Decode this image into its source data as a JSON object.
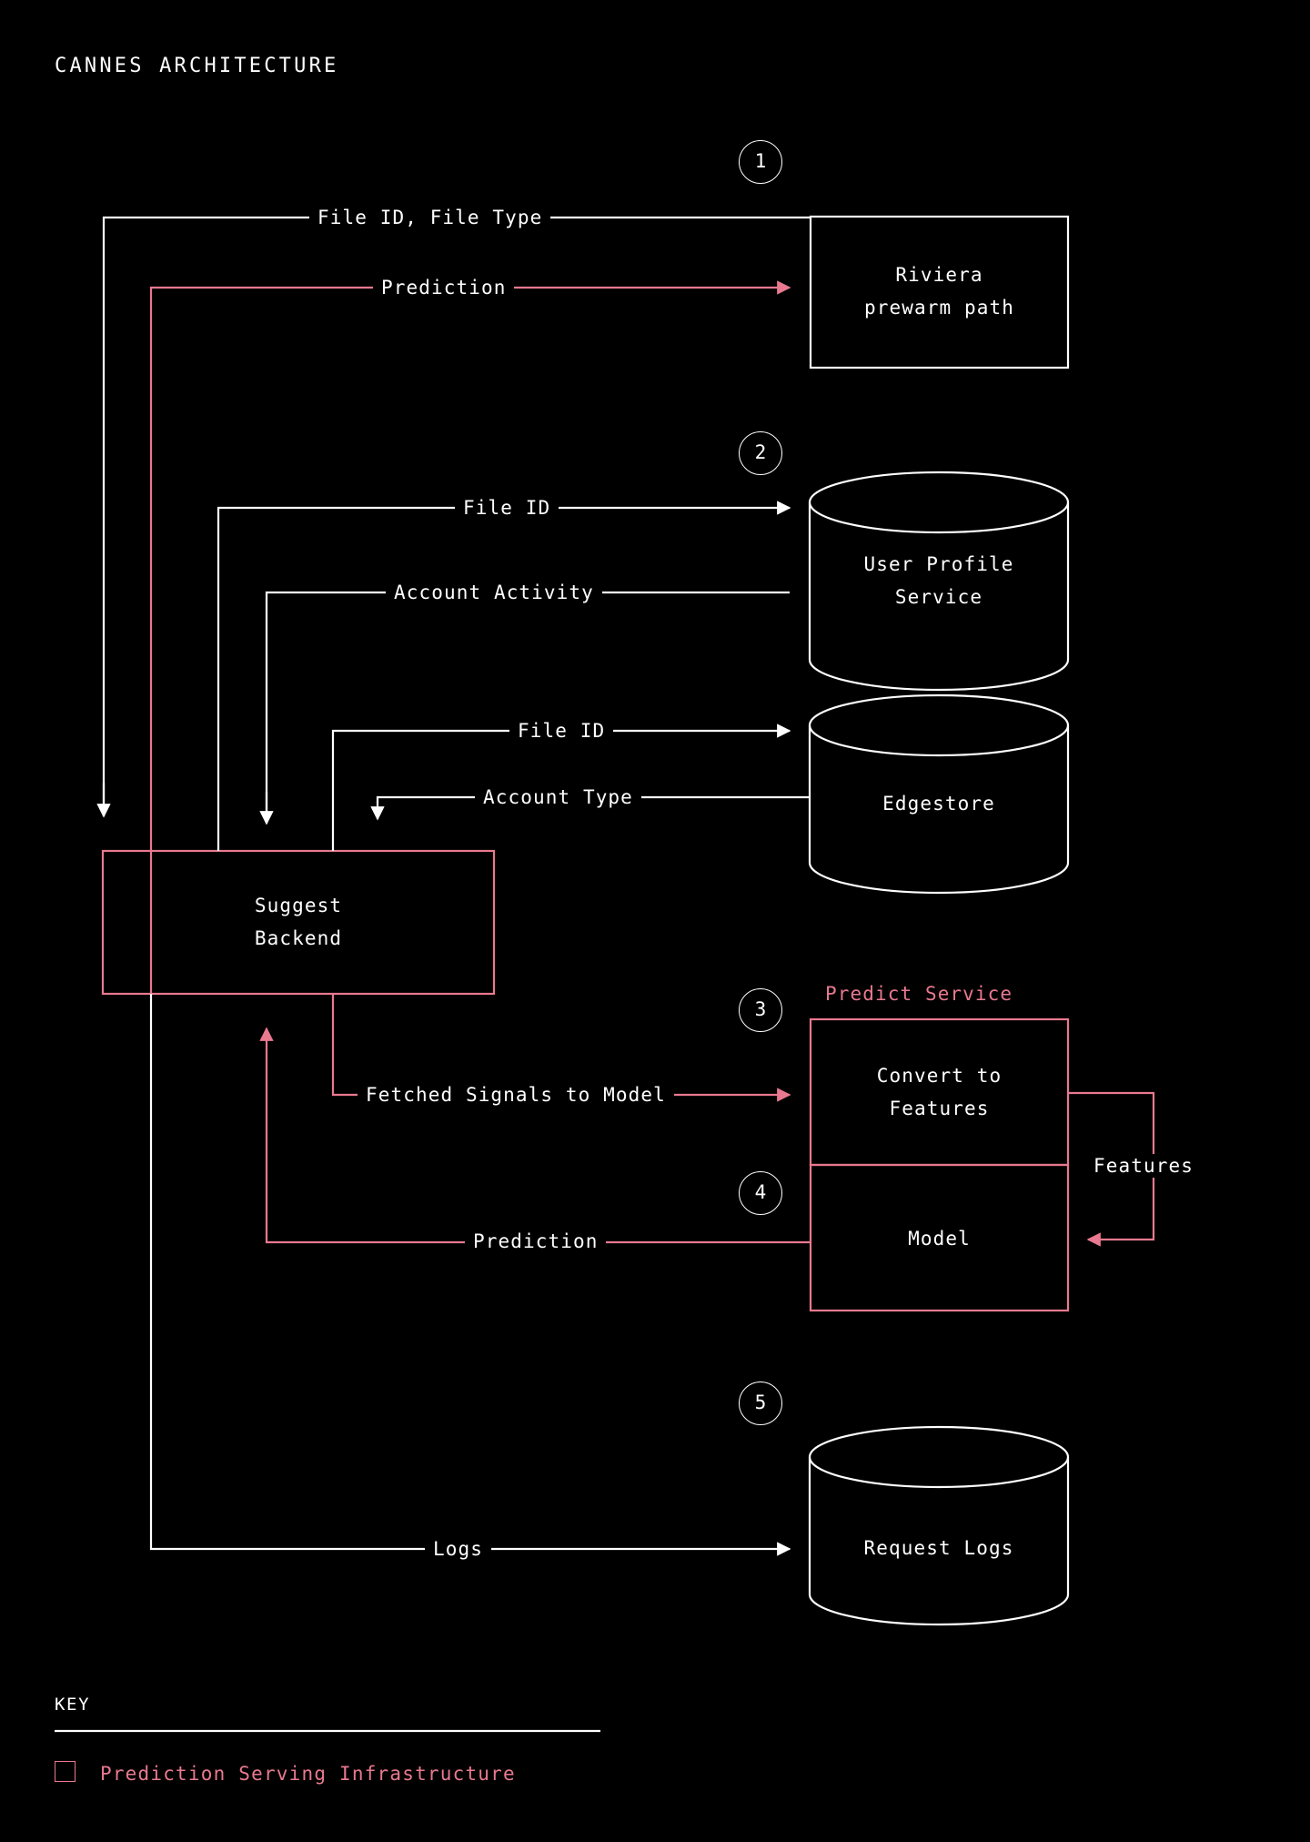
{
  "page": {
    "title": "CANNES ARCHITECTURE",
    "background_color": "#000000",
    "line_color": "#ffffff",
    "accent_color": "#e8798f"
  },
  "key": {
    "heading": "KEY",
    "items": [
      {
        "swatch": "pink-square-outline",
        "label": "Prediction Serving Infrastructure",
        "color": "#e8798f"
      }
    ]
  },
  "steps": [
    {
      "id": "step-1",
      "number": "1"
    },
    {
      "id": "step-2",
      "number": "2"
    },
    {
      "id": "step-3",
      "number": "3"
    },
    {
      "id": "step-4",
      "number": "4"
    },
    {
      "id": "step-5",
      "number": "5"
    }
  ],
  "nodes": {
    "riviera": {
      "label": "Riviera\nprewarm path",
      "shape": "rectangle",
      "color": "#ffffff"
    },
    "user_profile": {
      "label": "User Profile\nService",
      "shape": "cylinder",
      "color": "#ffffff"
    },
    "edgestore": {
      "label": "Edgestore",
      "shape": "cylinder",
      "color": "#ffffff"
    },
    "suggest_backend": {
      "label": "Suggest\nBackend",
      "shape": "rectangle",
      "color": "#e8798f"
    },
    "convert_to_features": {
      "label": "Convert to\nFeatures",
      "shape": "rectangle",
      "color": "#e8798f"
    },
    "model": {
      "label": "Model",
      "shape": "rectangle",
      "color": "#e8798f"
    },
    "request_logs": {
      "label": "Request Logs",
      "shape": "cylinder",
      "color": "#ffffff"
    }
  },
  "groups": {
    "predict_service": {
      "label": "Predict Service",
      "color": "#e8798f"
    }
  },
  "edges": [
    {
      "id": "edge-file-id-file-type",
      "label": "File ID, File Type",
      "color": "#ffffff",
      "from": "suggest_backend",
      "to": "riviera"
    },
    {
      "id": "edge-prediction-riviera",
      "label": "Prediction",
      "color": "#e8798f",
      "from": "suggest_backend",
      "to": "riviera"
    },
    {
      "id": "edge-file-id-ups",
      "label": "File ID",
      "color": "#ffffff",
      "from": "suggest_backend",
      "to": "user_profile"
    },
    {
      "id": "edge-account-activity",
      "label": "Account Activity",
      "color": "#ffffff",
      "from": "user_profile",
      "to": "suggest_backend"
    },
    {
      "id": "edge-file-id-edgestore",
      "label": "File ID",
      "color": "#ffffff",
      "from": "suggest_backend",
      "to": "edgestore"
    },
    {
      "id": "edge-account-type",
      "label": "Account Type",
      "color": "#ffffff",
      "from": "edgestore",
      "to": "suggest_backend"
    },
    {
      "id": "edge-fetched-signals",
      "label": "Fetched Signals to Model",
      "color": "#e8798f",
      "from": "suggest_backend",
      "to": "convert_to_features"
    },
    {
      "id": "edge-features",
      "label": "Features",
      "color": "#ffffff",
      "from": "convert_to_features",
      "to": "model"
    },
    {
      "id": "edge-prediction-model",
      "label": "Prediction",
      "color": "#e8798f",
      "from": "model",
      "to": "suggest_backend"
    },
    {
      "id": "edge-logs",
      "label": "Logs",
      "color": "#ffffff",
      "from": "suggest_backend",
      "to": "request_logs"
    }
  ]
}
